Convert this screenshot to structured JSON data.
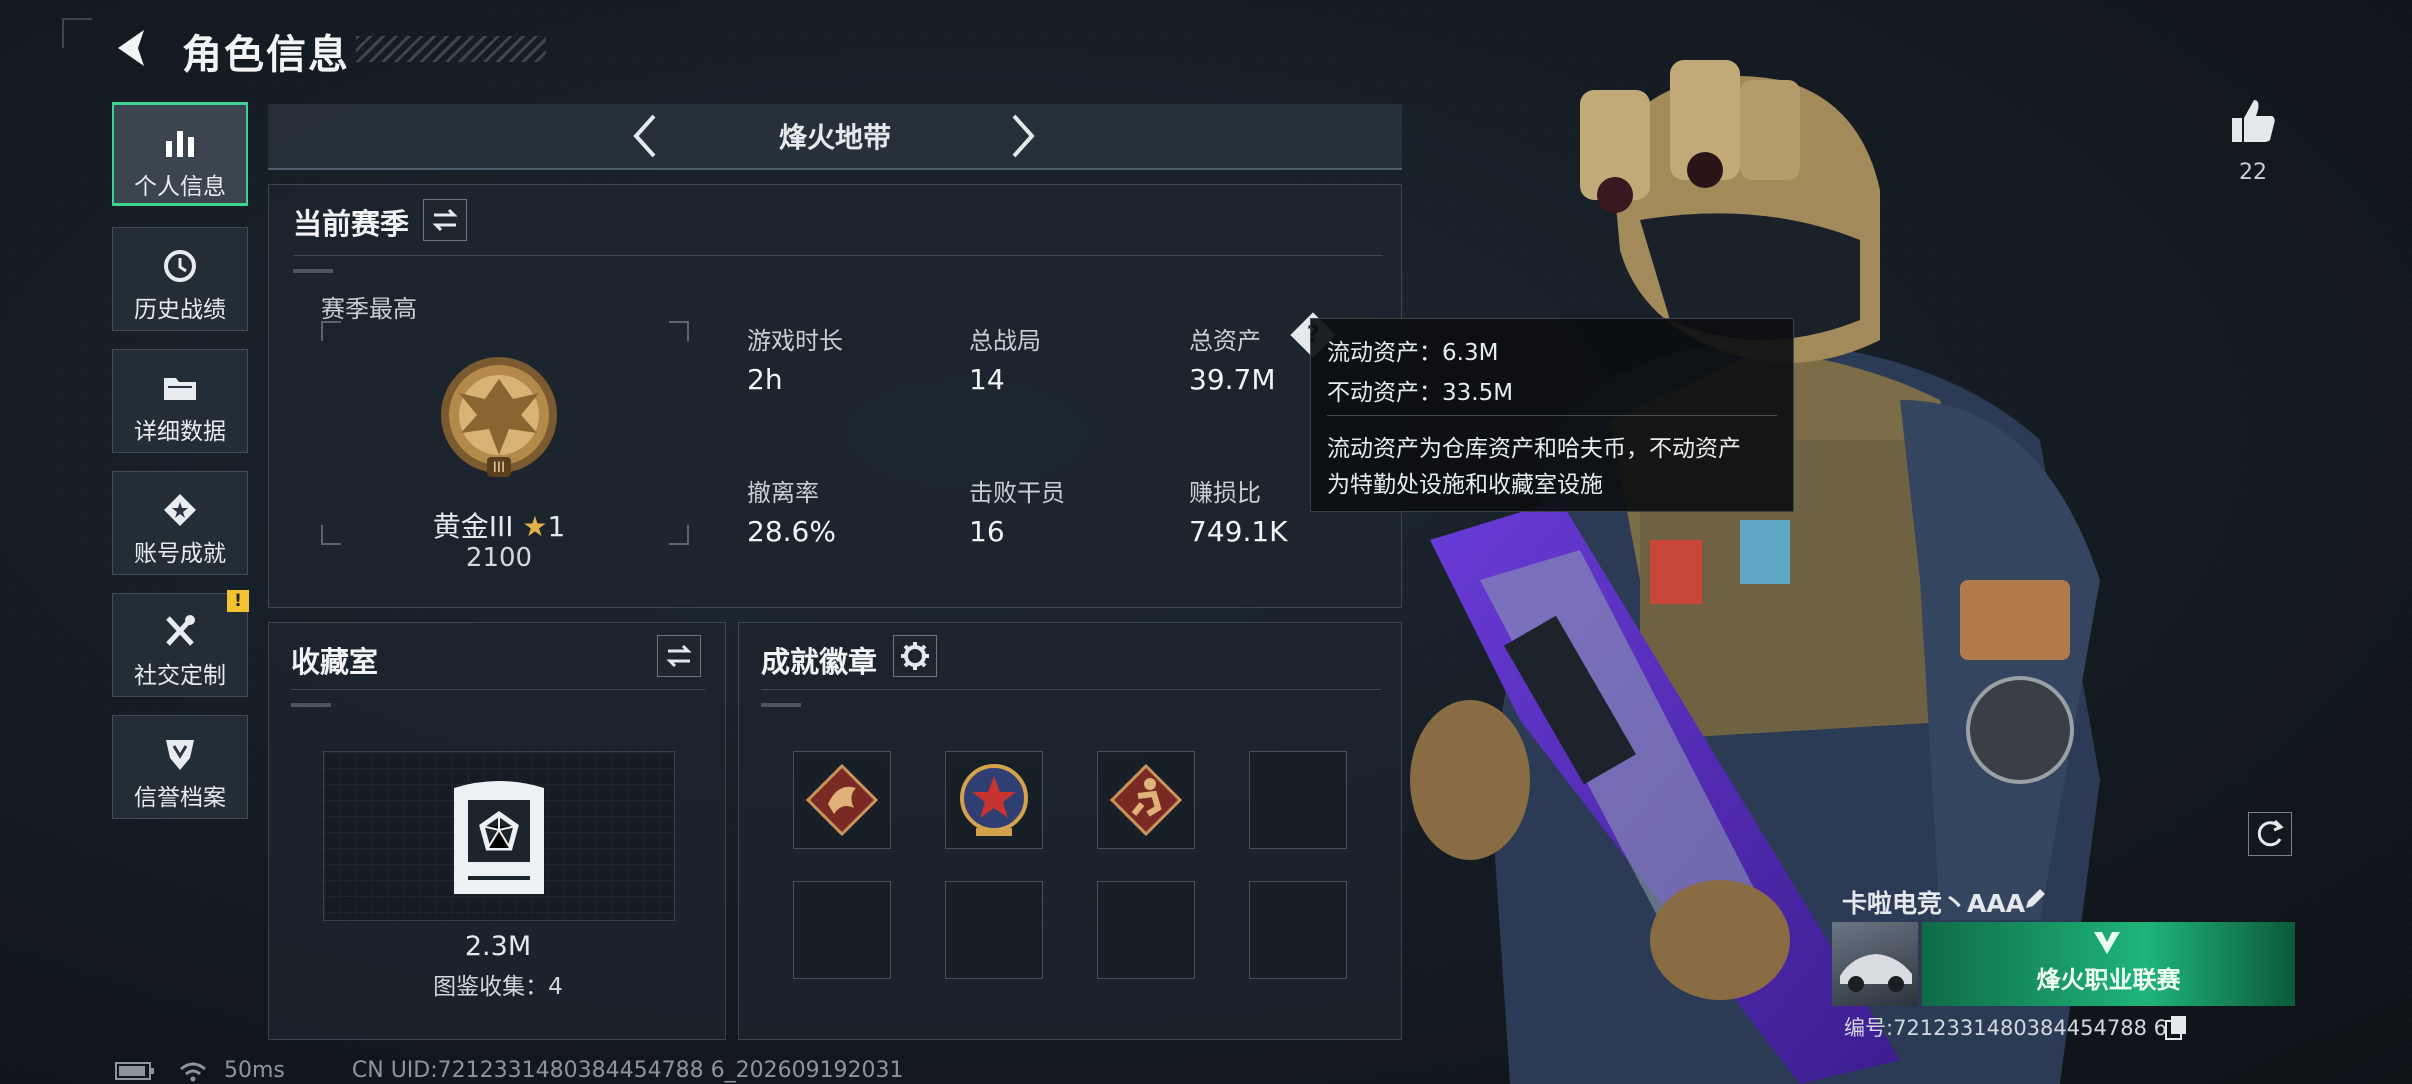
{
  "header": {
    "title": "角色信息"
  },
  "sidebar": {
    "items": [
      {
        "label": "个人信息",
        "icon": "bar-chart-icon",
        "active": true
      },
      {
        "label": "历史战绩",
        "icon": "history-clock-icon"
      },
      {
        "label": "详细数据",
        "icon": "folder-icon"
      },
      {
        "label": "账号成就",
        "icon": "achievement-badge-icon"
      },
      {
        "label": "社交定制",
        "icon": "tools-icon",
        "badge": "!"
      },
      {
        "label": "信誉档案",
        "icon": "shield-emblem-icon"
      }
    ]
  },
  "mode": {
    "label": "烽火地带"
  },
  "season": {
    "title": "当前赛季",
    "highest_label": "赛季最高",
    "rank_name": "黄金III",
    "rank_stars": "1",
    "rank_score": "2100",
    "stats": [
      {
        "label": "游戏时长",
        "value": "2h"
      },
      {
        "label": "总战局",
        "value": "14"
      },
      {
        "label": "总资产",
        "value": "39.7M"
      },
      {
        "label": "撤离率",
        "value": "28.6%"
      },
      {
        "label": "击败干员",
        "value": "16"
      },
      {
        "label": "赚损比",
        "value": "749.1K"
      }
    ]
  },
  "tooltip": {
    "liquid": "流动资产：6.3M",
    "fixed": "不动资产：33.5M",
    "desc_line1": "流动资产为仓库资产和哈夫币，不动资产",
    "desc_line2": "为特勤处设施和收藏室设施"
  },
  "collection": {
    "title": "收藏室",
    "value": "2.3M",
    "count_label": "图鉴收集：4"
  },
  "badges": {
    "title": "成就徽章"
  },
  "likes": {
    "count": "22"
  },
  "player": {
    "name": "卡啦电竞丶AAA",
    "id_label": "编号:7212331480384454788 6",
    "banner_text": "烽火职业联赛"
  },
  "status": {
    "ping": "50ms",
    "uid": "CN UID:7212331480384454788 6_202609192031"
  },
  "colors": {
    "accent": "#3bd38f",
    "warning": "#f2c230",
    "panel": "#1c252e"
  }
}
